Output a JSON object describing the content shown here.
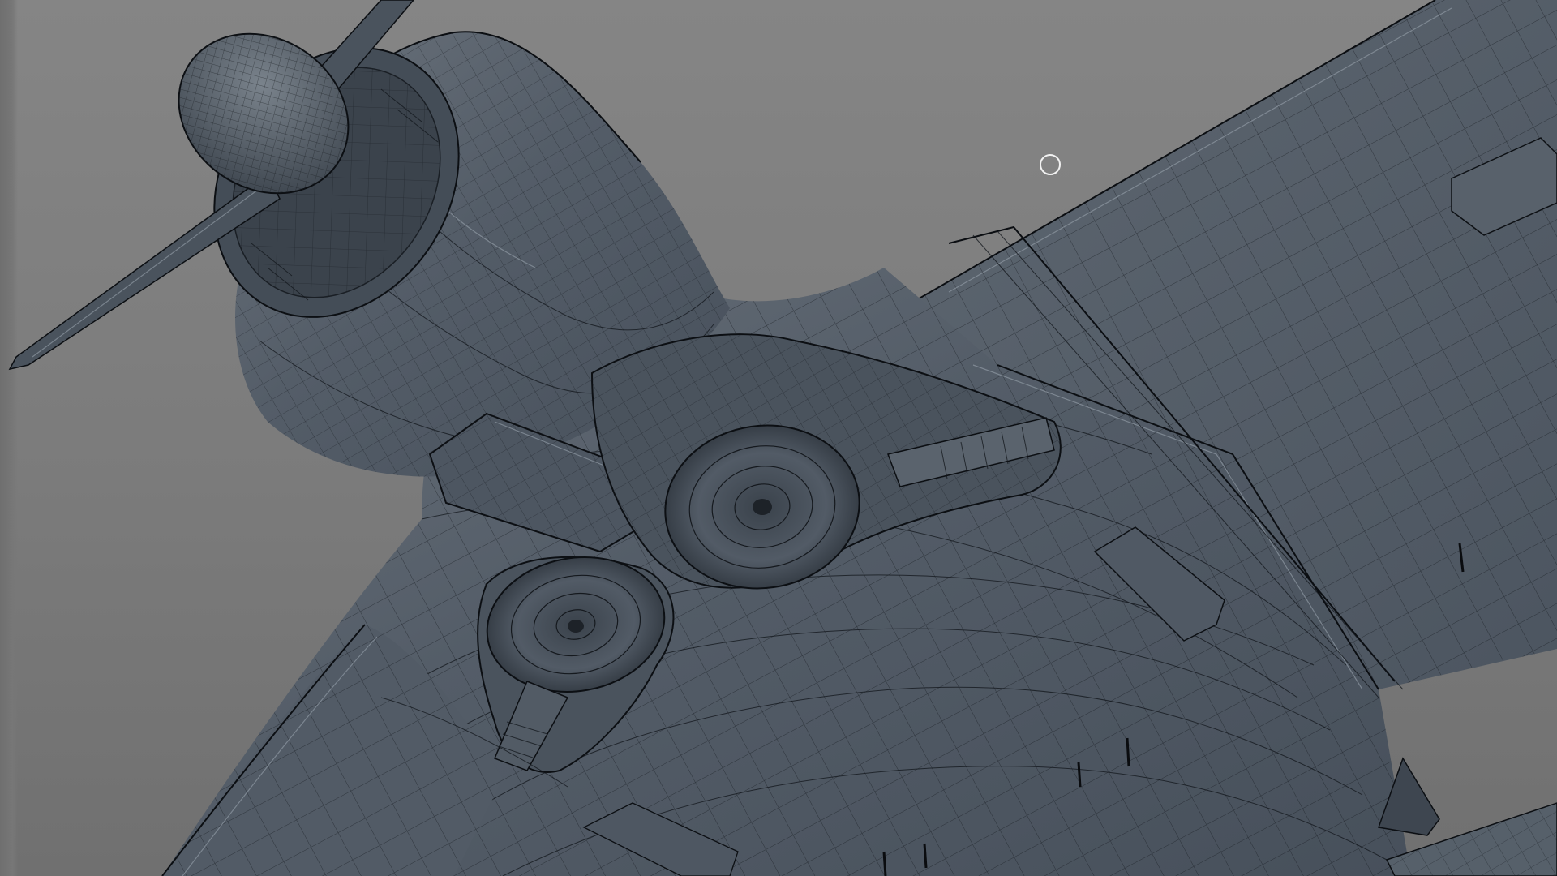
{
  "viewport": {
    "background_color": "#7c7c7c",
    "model_color": "#4f5863",
    "wire_color": "#12161b"
  },
  "cursor": {
    "icon": "circle-cursor-icon"
  }
}
